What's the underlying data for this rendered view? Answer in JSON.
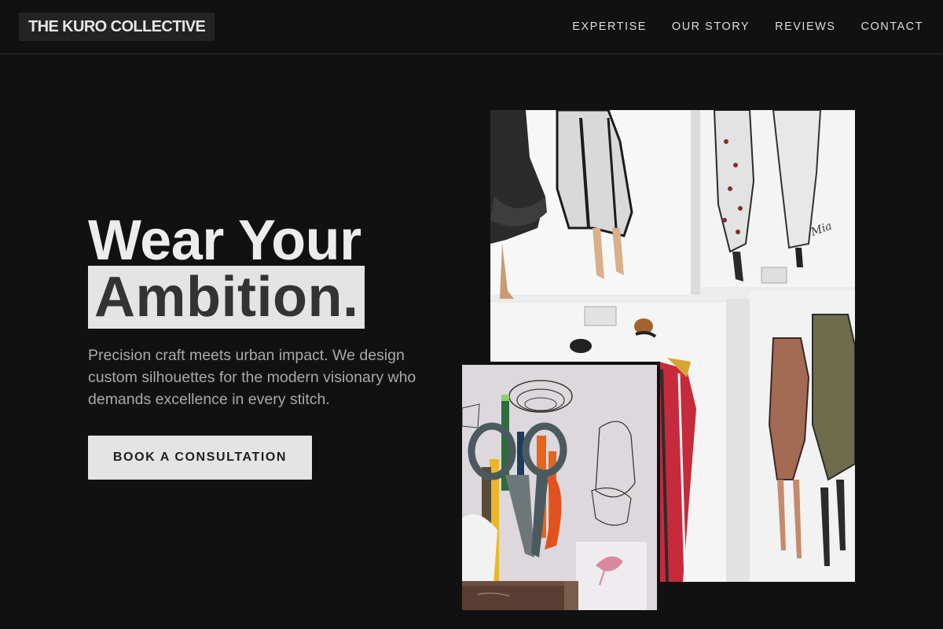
{
  "brand": {
    "name": "THE KURO COLLECTIVE"
  },
  "nav": {
    "items": [
      {
        "label": "EXPERTISE"
      },
      {
        "label": "OUR STORY"
      },
      {
        "label": "REVIEWS"
      },
      {
        "label": "CONTACT"
      }
    ]
  },
  "hero": {
    "title_line1": "Wear Your",
    "title_line2": "Ambition.",
    "description": "Precision craft meets urban impact. We design custom silhouettes for the modern visionary who demands excellence in every stitch.",
    "cta_label": "BOOK A CONSULTATION"
  },
  "images": {
    "main_alt": "Fashion sketches pinned to a wall",
    "secondary_alt": "Scissors and pencils in a holder in front of sketches"
  },
  "colors": {
    "background": "#111111",
    "text": "#e9e9e9",
    "muted_text": "#a9a9a9",
    "highlight": "#e4e4e4",
    "highlight_text": "#333333"
  }
}
